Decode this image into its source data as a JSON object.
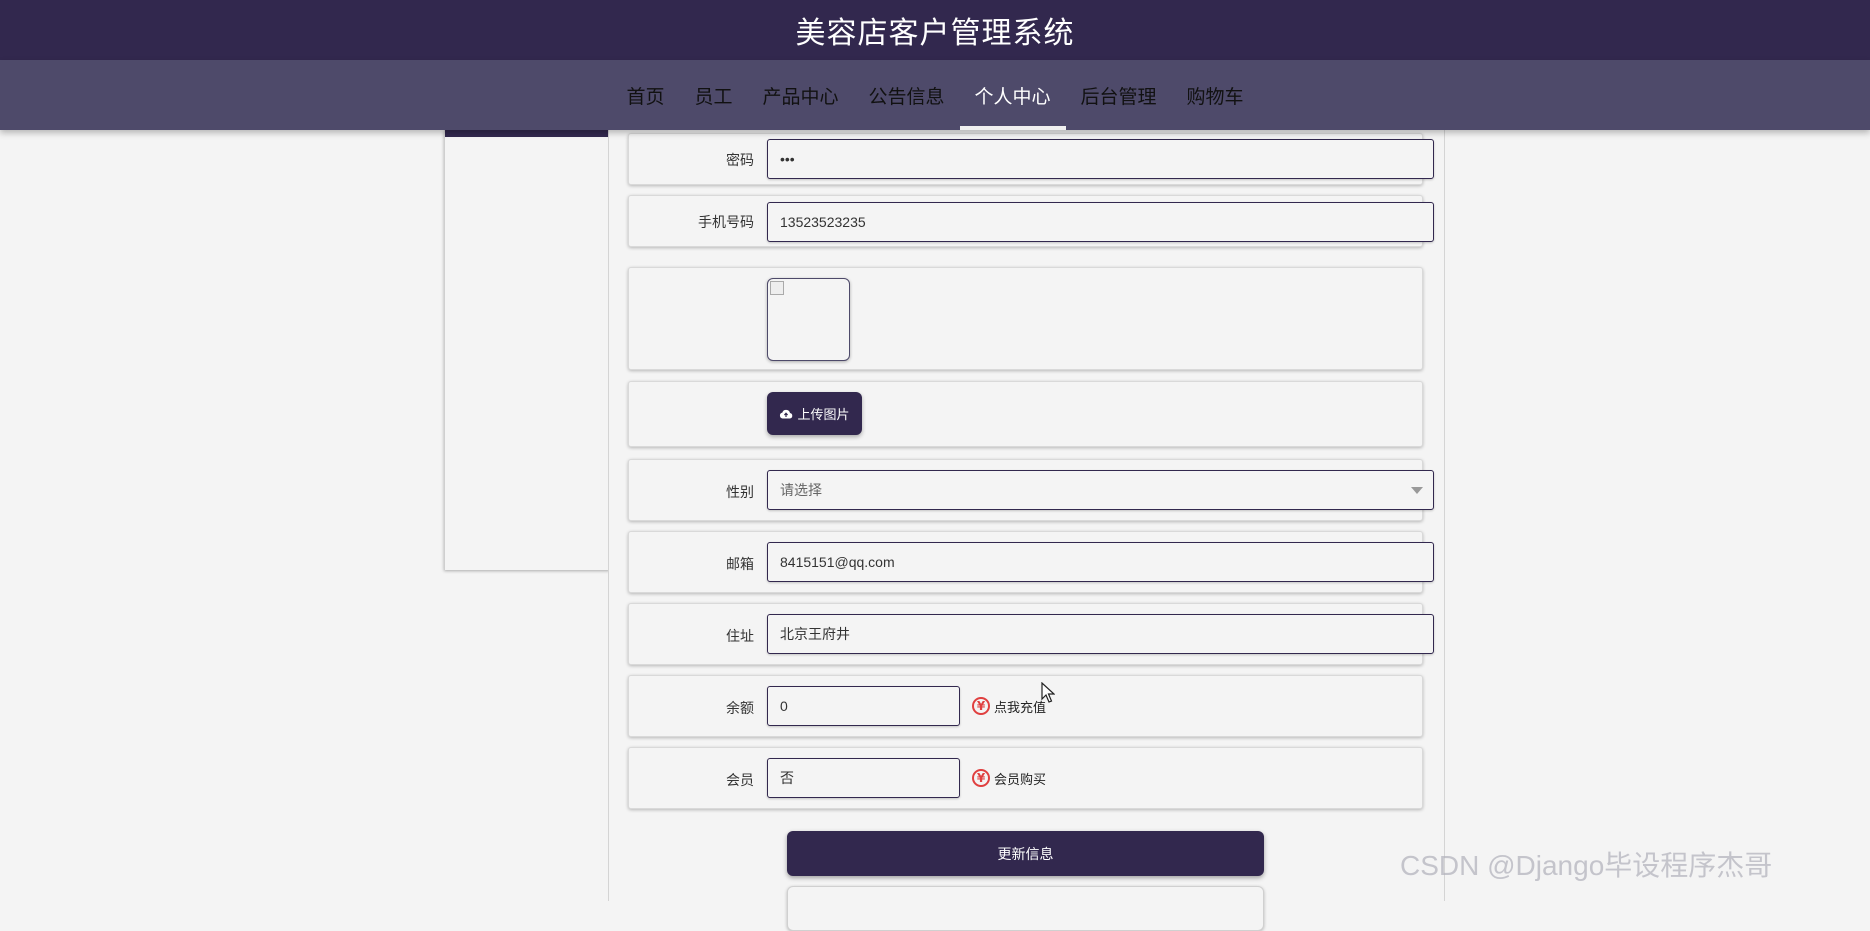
{
  "app": {
    "title": "美容店客户管理系统"
  },
  "nav": {
    "items": [
      {
        "label": "首页"
      },
      {
        "label": "员工"
      },
      {
        "label": "产品中心"
      },
      {
        "label": "公告信息"
      },
      {
        "label": "个人中心",
        "active": true
      },
      {
        "label": "后台管理"
      },
      {
        "label": "购物车"
      }
    ]
  },
  "form": {
    "password": {
      "label": "密码",
      "value": "•••"
    },
    "phone": {
      "label": "手机号码",
      "value": "13523523235"
    },
    "upload_label": "上传图片",
    "gender": {
      "label": "性别",
      "placeholder": "请选择"
    },
    "email": {
      "label": "邮箱",
      "value": "8415151@qq.com"
    },
    "address": {
      "label": "住址",
      "value": "北京王府井"
    },
    "balance": {
      "label": "余额",
      "value": "0",
      "link": "点我充值"
    },
    "member": {
      "label": "会员",
      "value": "否",
      "link": "会员购买"
    },
    "update_label": "更新信息"
  },
  "icons": {
    "upload": "cloud-upload-icon",
    "yen": "yen-icon",
    "cursor": "mouse-cursor-icon",
    "yen_glyph": "¥"
  },
  "colors": {
    "primary": "#32284e",
    "nav_bg": "#4e4a6a",
    "yen": "#e04040"
  },
  "watermark": "CSDN @Django毕设程序杰哥"
}
